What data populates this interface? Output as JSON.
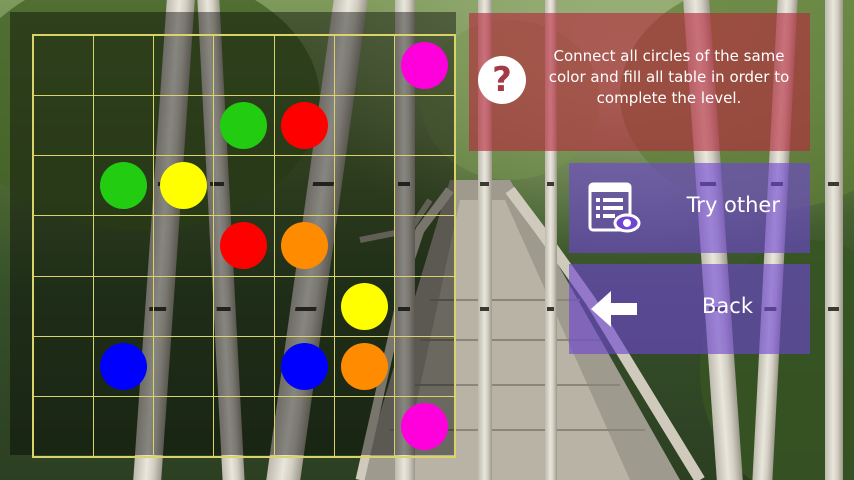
{
  "info": {
    "text": "Connect all circles of the same color and fill all table in order to complete the level.",
    "icon": "question-mark-icon",
    "icon_glyph": "?"
  },
  "buttons": {
    "try_other": {
      "label": "Try other",
      "icon": "list-view-icon"
    },
    "back": {
      "label": "Back",
      "icon": "arrow-left-icon"
    }
  },
  "colors": {
    "magenta": "#ff00dd",
    "green": "#22cc11",
    "red": "#ff0000",
    "yellow": "#ffff00",
    "orange": "#ff8c00",
    "blue": "#0000ff",
    "info_panel": "#b4283c",
    "button_panel": "#6e46d2",
    "grid_line": "#d9d36a"
  },
  "board": {
    "rows": 7,
    "cols": 7,
    "dots": [
      {
        "row": 0,
        "col": 6,
        "color": "magenta"
      },
      {
        "row": 1,
        "col": 3,
        "color": "green"
      },
      {
        "row": 1,
        "col": 4,
        "color": "red"
      },
      {
        "row": 2,
        "col": 1,
        "color": "green"
      },
      {
        "row": 2,
        "col": 2,
        "color": "yellow"
      },
      {
        "row": 3,
        "col": 3,
        "color": "red"
      },
      {
        "row": 3,
        "col": 4,
        "color": "orange"
      },
      {
        "row": 4,
        "col": 5,
        "color": "yellow"
      },
      {
        "row": 5,
        "col": 1,
        "color": "blue"
      },
      {
        "row": 5,
        "col": 4,
        "color": "blue"
      },
      {
        "row": 5,
        "col": 5,
        "color": "orange"
      },
      {
        "row": 6,
        "col": 6,
        "color": "magenta"
      }
    ]
  }
}
